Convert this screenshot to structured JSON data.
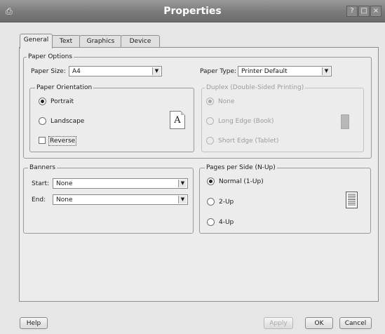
{
  "window": {
    "title": "Properties",
    "icon": "printer-icon",
    "help_glyph": "?",
    "minimize_glyph": "□",
    "close_glyph": "×"
  },
  "tabs": [
    {
      "label": "General",
      "active": true
    },
    {
      "label": "Text",
      "active": false
    },
    {
      "label": "Graphics",
      "active": false
    },
    {
      "label": "Device",
      "active": false
    }
  ],
  "paper_options": {
    "legend": "Paper Options",
    "paper_size_label": "Paper Size:",
    "paper_size_value": "A4",
    "paper_type_label": "Paper Type:",
    "paper_type_value": "Printer Default",
    "orientation": {
      "legend": "Paper Orientation",
      "portrait": "Portrait",
      "landscape": "Landscape",
      "reverse": "Reverse",
      "selected": "Portrait",
      "preview_glyph": "A"
    },
    "duplex": {
      "legend": "Duplex (Double-Sided Printing)",
      "none": "None",
      "long_edge": "Long Edge (Book)",
      "short_edge": "Short Edge (Tablet)",
      "selected": "None",
      "enabled": false
    }
  },
  "banners": {
    "legend": "Banners",
    "start_label": "Start:",
    "start_value": "None",
    "end_label": "End:",
    "end_value": "None"
  },
  "pages_per_side": {
    "legend": "Pages per Side (N-Up)",
    "normal": "Normal (1-Up)",
    "two": "2-Up",
    "four": "4-Up",
    "selected": "Normal (1-Up)"
  },
  "footer": {
    "help": "Help",
    "apply": "Apply",
    "ok": "OK",
    "cancel": "Cancel"
  }
}
